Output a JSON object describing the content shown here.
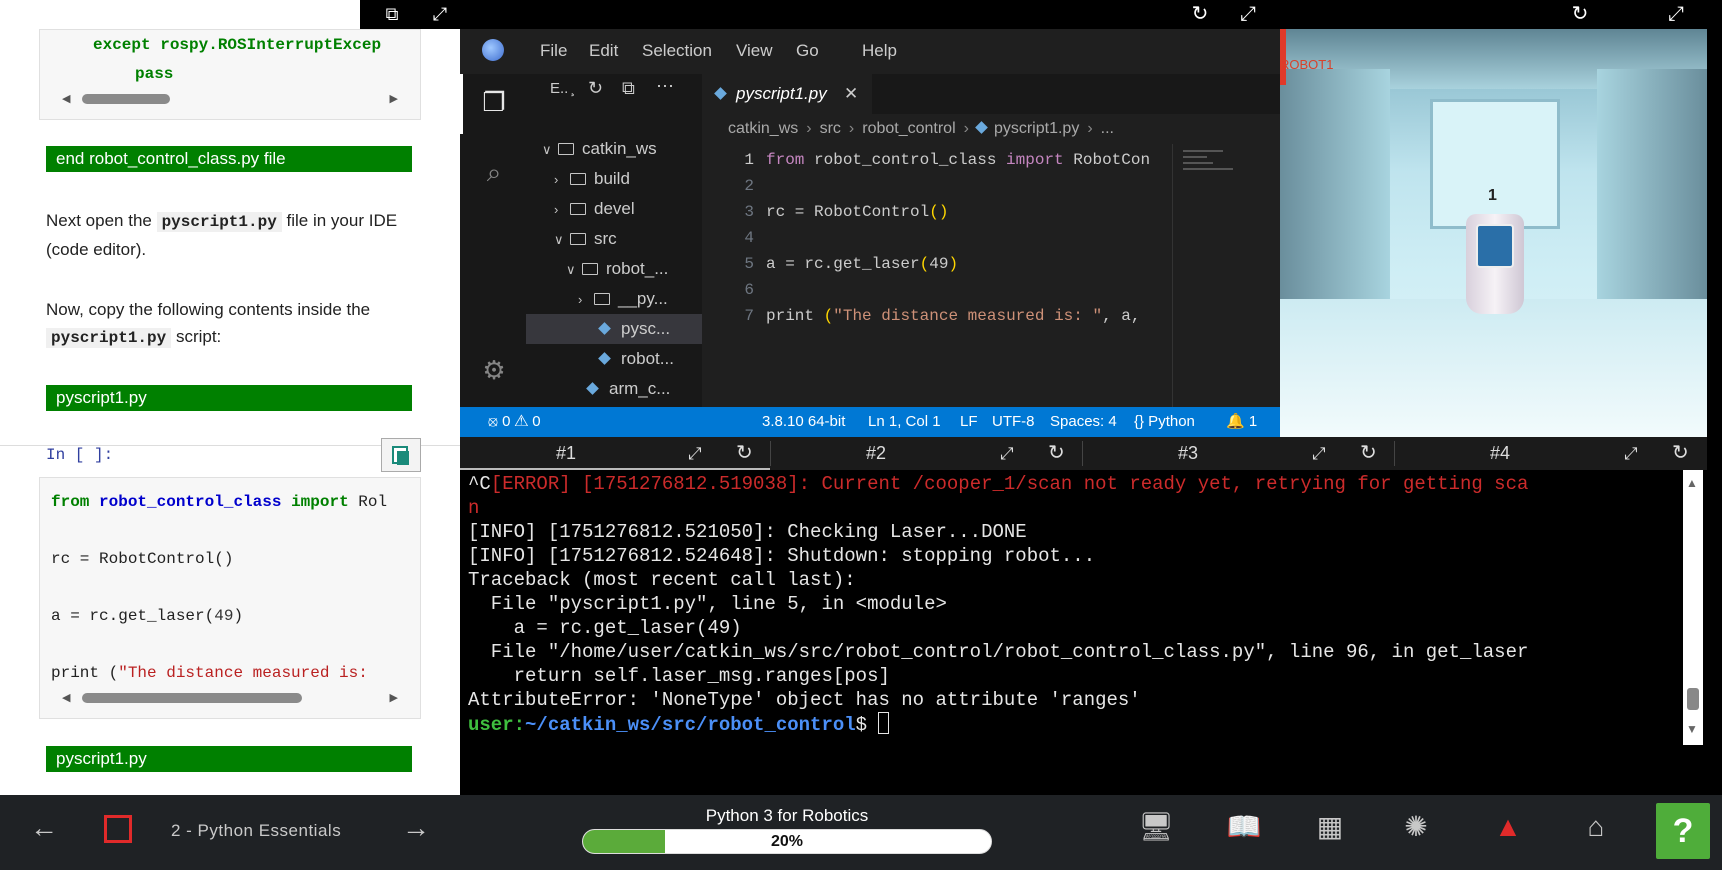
{
  "notebook": {
    "cell_top_lines": [
      "except rospy.ROSInterruptExcep",
      "pass"
    ],
    "end_file_banner": "end robot_control_class.py file",
    "para1_before": "Next open the ",
    "para1_code": "pyscript1.py",
    "para1_after": " file in your IDE (code editor).",
    "para2_before": "Now, copy the following contents inside the ",
    "para2_code": "pyscript1.py",
    "para2_after": " script:",
    "banner1": "pyscript1.py",
    "in_prompt": "In [ ]:",
    "code_lines": {
      "l1_kw1": "from",
      "l1_mod": "robot_control_class",
      "l1_kw2": "import",
      "l1_rest": "Rol",
      "l3": "rc = RobotControl()",
      "l5_a": "a = rc.get_laser(",
      "l5_num": "49",
      "l5_b": ")",
      "l7_a": "print (",
      "l7_str": "\"The distance measured is: "
    },
    "banner2": "pyscript1.py"
  },
  "ide": {
    "menu": [
      "File",
      "Edit",
      "Selection",
      "View",
      "Go",
      "Help"
    ],
    "explorer_header": "E.. ̧",
    "explorer_actions": [
      "↻",
      "⧉",
      "⋯"
    ],
    "tree": [
      {
        "label": "catkin_ws",
        "type": "folder",
        "chev": "∨"
      },
      {
        "label": "build",
        "type": "folder",
        "chev": "›"
      },
      {
        "label": "devel",
        "type": "folder",
        "chev": "›"
      },
      {
        "label": "src",
        "type": "folder",
        "chev": "∨"
      },
      {
        "label": "robot_...",
        "type": "folder",
        "chev": "∨"
      },
      {
        "label": "__py...",
        "type": "folder",
        "chev": "›"
      },
      {
        "label": "pysc...",
        "type": "file"
      },
      {
        "label": "robot...",
        "type": "file"
      },
      {
        "label": "arm_c...",
        "type": "file"
      }
    ],
    "tab_name": "pyscript1.py",
    "tab_close": "✕",
    "breadcrumbs": [
      "catkin_ws",
      "src",
      "robot_control",
      "pyscript1.py",
      "..."
    ],
    "code": {
      "l1_from": "from",
      "l1_mod": " robot_control_class ",
      "l1_import": "import",
      "l1_rest": " RobotCon",
      "l3_a": "rc = ",
      "l3_f": "RobotControl",
      "l3_p": "()",
      "l5_a": "a = rc.",
      "l5_f": "get_laser",
      "l5_p1": "(",
      "l5_n": "49",
      "l5_p2": ")",
      "l7_f": "print",
      "l7_sp": " ",
      "l7_p": "(",
      "l7_s": "\"The distance measured is: \"",
      "l7_rest": ", a,"
    },
    "line_numbers": [
      "1",
      "2",
      "3",
      "4",
      "5",
      "6",
      "7"
    ],
    "status": {
      "problems": "⦻ 0 ⚠ 0",
      "python_version": "3.8.10 64-bit",
      "position": "Ln 1, Col 1",
      "eol": "LF",
      "encoding": "UTF-8",
      "spaces": "Spaces: 4",
      "language": "{} Python",
      "notifications": "🔔 1"
    }
  },
  "sim": {
    "label": "ROBOT1",
    "robot_number": "1"
  },
  "terminal": {
    "tabs": [
      "#1",
      "#2",
      "#3",
      "#4"
    ],
    "line1_prefix": "^C",
    "line1_error": "[ERROR] [1751276812.519038]: Current /cooper_1/scan not ready yet, retrying for getting sca",
    "line1_wrap": "n",
    "lines": [
      "[INFO] [1751276812.521050]: Checking Laser...DONE",
      "[INFO] [1751276812.524648]: Shutdown: stopping robot...",
      "Traceback (most recent call last):",
      "  File \"pyscript1.py\", line 5, in <module>",
      "    a = rc.get_laser(49)",
      "  File \"/home/user/catkin_ws/src/robot_control/robot_control_class.py\", line 96, in get_laser",
      "    return self.laser_msg.ranges[pos]",
      "AttributeError: 'NoneType' object has no attribute 'ranges'"
    ],
    "prompt_user": "user:",
    "prompt_path": "~/catkin_ws/src/robot_control",
    "prompt_symbol": "$ "
  },
  "bottombar": {
    "chapter": "2 - Python Essentials",
    "course_title": "Python 3 for Robotics",
    "progress_label": "20%",
    "progress_value": 0.2,
    "help": "?",
    "brand_colors": {
      "green": "#4fad3a",
      "red": "#e02a2a"
    }
  }
}
